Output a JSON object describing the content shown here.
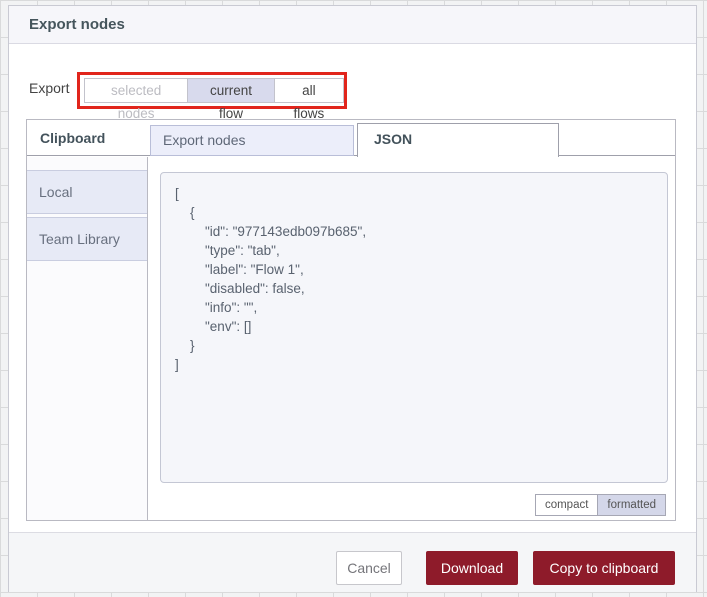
{
  "dialog": {
    "title": "Export nodes"
  },
  "export_row": {
    "label": "Export",
    "options": [
      {
        "label": "selected nodes",
        "state": "disabled"
      },
      {
        "label": "current flow",
        "state": "selected"
      },
      {
        "label": "all flows",
        "state": "normal"
      }
    ]
  },
  "panel": {
    "clipboard_label": "Clipboard",
    "tabs": [
      {
        "label": "Export nodes",
        "active": false
      },
      {
        "label": "JSON",
        "active": true
      }
    ],
    "sidebar": [
      {
        "label": "Local"
      },
      {
        "label": "Team Library"
      }
    ]
  },
  "code": {
    "content": "[\n    {\n        \"id\": \"977143edb097b685\",\n        \"type\": \"tab\",\n        \"label\": \"Flow 1\",\n        \"disabled\": false,\n        \"info\": \"\",\n        \"env\": []\n    }\n]",
    "format_buttons": {
      "compact": "compact",
      "formatted": "formatted",
      "selected": "formatted"
    }
  },
  "footer": {
    "cancel": "Cancel",
    "download": "Download",
    "copy": "Copy to clipboard"
  },
  "colors": {
    "primary_button_red": "#8e1b2a",
    "annotation_red": "#e1251c",
    "selected_toggle_bg": "#d8daed",
    "title_text": "#45555c",
    "code_panel_bg": "#f5f6fa"
  }
}
